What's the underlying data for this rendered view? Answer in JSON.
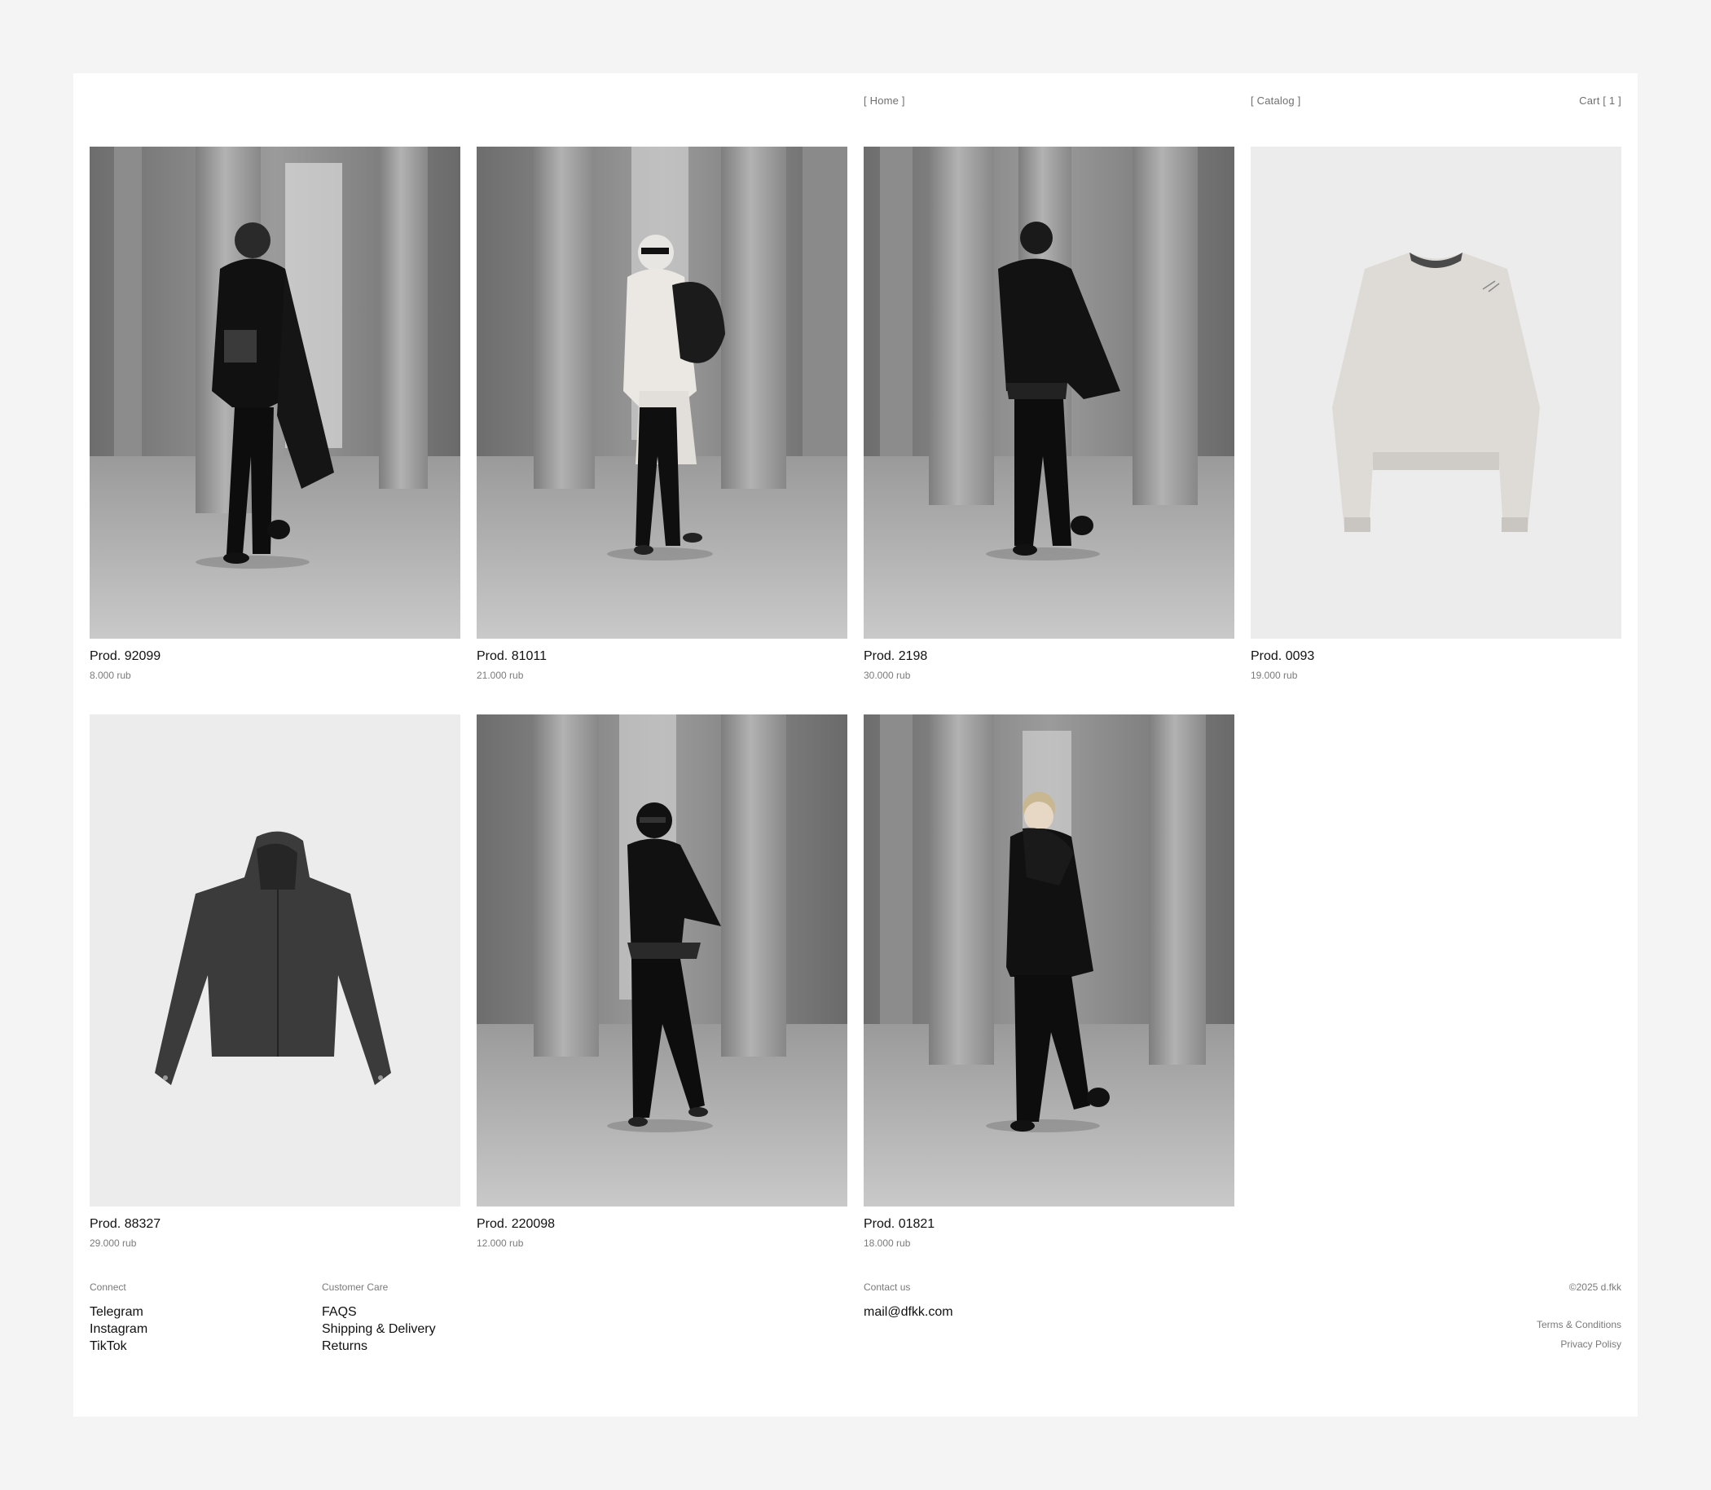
{
  "nav": {
    "home": "[ Home ]",
    "catalog": "[ Catalog ]",
    "cart": "Cart [ 1 ]"
  },
  "products": [
    {
      "name": "Prod. 92099",
      "price": "8.000 rub",
      "photo": "model-black-hooded-coat-with-bag"
    },
    {
      "name": "Prod. 81011",
      "price": "21.000 rub",
      "photo": "model-white-hooded-top-with-sunglasses"
    },
    {
      "name": "Prod. 2198",
      "price": "30.000 rub",
      "photo": "model-black-jacket-beanie"
    },
    {
      "name": "Prod. 0093",
      "price": "19.000 rub",
      "photo": "light-grey-sweatshirt-product-shot"
    },
    {
      "name": "Prod. 88327",
      "price": "29.000 rub",
      "photo": "dark-grey-hooded-jacket-product-shot"
    },
    {
      "name": "Prod. 220098",
      "price": "12.000 rub",
      "photo": "model-black-outfit-belt-sunglasses"
    },
    {
      "name": "Prod. 01821",
      "price": "18.000 rub",
      "photo": "model-black-suit-scarf"
    }
  ],
  "footer": {
    "connect": {
      "heading": "Connect",
      "links": [
        "Telegram",
        "Instagram",
        "TikTok"
      ]
    },
    "customer_care": {
      "heading": "Customer Care",
      "links": [
        "FAQS",
        "Shipping & Delivery",
        "Returns"
      ]
    },
    "contact": {
      "heading": "Contact us",
      "email": "mail@dfkk.com"
    },
    "copyright": "©2025 d.fkk",
    "terms": "Terms & Conditions",
    "privacy": "Privacy Polisy"
  },
  "colors": {
    "page_background": "#f4f4f4",
    "frame_background": "#ffffff",
    "muted_text": "#7a7a7a",
    "primary_text": "#111111",
    "studio_background": "#ececec"
  }
}
